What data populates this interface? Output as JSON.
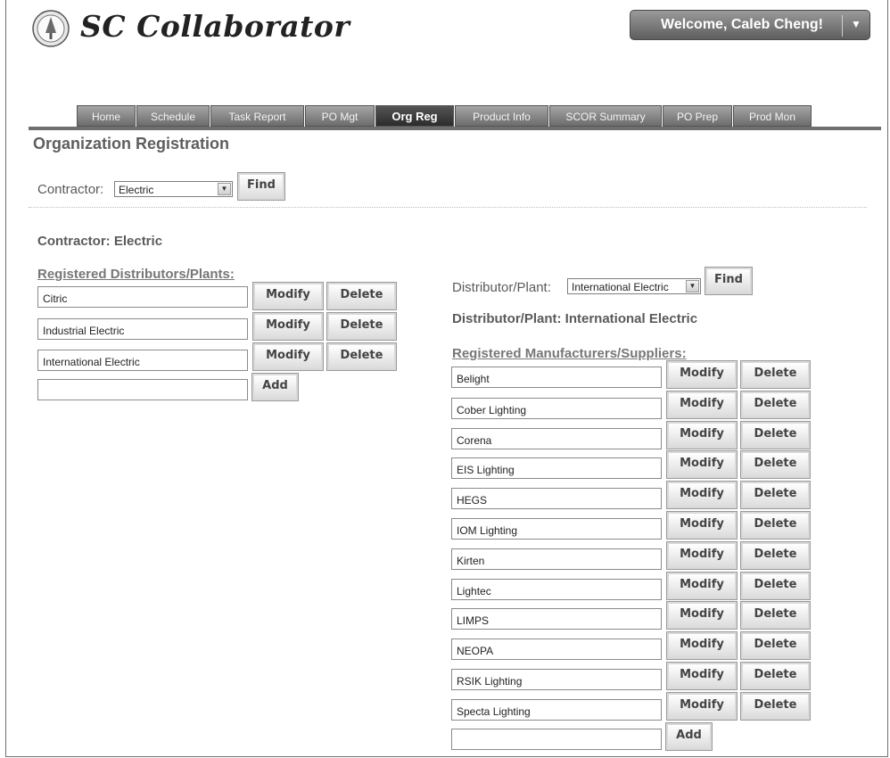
{
  "header": {
    "brand": "SC Collaborator",
    "welcome": "Welcome, Caleb Cheng!",
    "menu_caret": "▼"
  },
  "nav": {
    "tabs": [
      {
        "label": "Home"
      },
      {
        "label": "Schedule"
      },
      {
        "label": "Task Report"
      },
      {
        "label": "PO Mgt"
      },
      {
        "label": "Org Reg",
        "active": true
      },
      {
        "label": "Product Info"
      },
      {
        "label": "SCOR Summary"
      },
      {
        "label": "PO Prep"
      },
      {
        "label": "Prod Mon"
      }
    ]
  },
  "page": {
    "title": "Organization Registration",
    "contractor_label": "Contractor:",
    "contractor_select": "Electric",
    "find_label": "Find",
    "contractor_heading": "Contractor: Electric",
    "distributors_heading": "Registered Distributors/Plants:",
    "distributors": [
      "Citric",
      "Industrial Electric",
      "International Electric"
    ],
    "modify_label": "Modify",
    "delete_label": "Delete",
    "add_label": "Add",
    "dist_label": "Distributor/Plant:",
    "dist_select": "International Electric",
    "dist_heading": "Distributor/Plant: International Electric",
    "manufacturers_heading": "Registered Manufacturers/Suppliers:",
    "manufacturers": [
      "Belight",
      "Cober Lighting",
      "Corena",
      "EIS Lighting",
      "HEGS",
      "IOM Lighting",
      "Kirten",
      "Lightec",
      "LIMPS",
      "NEOPA",
      "RSIK Lighting",
      "Specta Lighting"
    ]
  }
}
